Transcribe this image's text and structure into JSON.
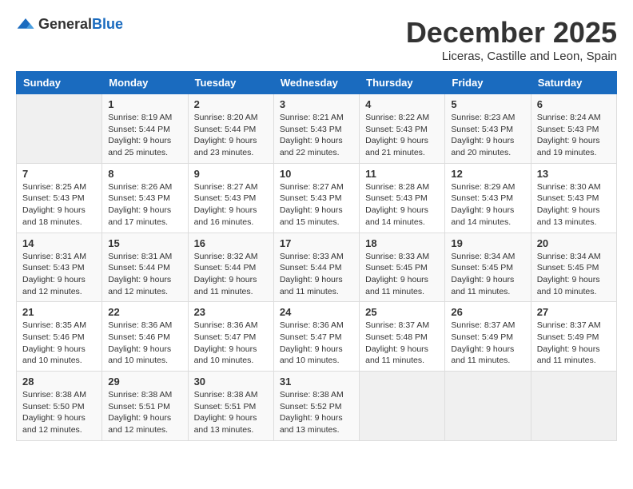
{
  "header": {
    "logo_general": "General",
    "logo_blue": "Blue",
    "month_year": "December 2025",
    "location": "Liceras, Castille and Leon, Spain"
  },
  "days_of_week": [
    "Sunday",
    "Monday",
    "Tuesday",
    "Wednesday",
    "Thursday",
    "Friday",
    "Saturday"
  ],
  "weeks": [
    [
      {
        "day": "",
        "info": ""
      },
      {
        "day": "1",
        "info": "Sunrise: 8:19 AM\nSunset: 5:44 PM\nDaylight: 9 hours\nand 25 minutes."
      },
      {
        "day": "2",
        "info": "Sunrise: 8:20 AM\nSunset: 5:44 PM\nDaylight: 9 hours\nand 23 minutes."
      },
      {
        "day": "3",
        "info": "Sunrise: 8:21 AM\nSunset: 5:43 PM\nDaylight: 9 hours\nand 22 minutes."
      },
      {
        "day": "4",
        "info": "Sunrise: 8:22 AM\nSunset: 5:43 PM\nDaylight: 9 hours\nand 21 minutes."
      },
      {
        "day": "5",
        "info": "Sunrise: 8:23 AM\nSunset: 5:43 PM\nDaylight: 9 hours\nand 20 minutes."
      },
      {
        "day": "6",
        "info": "Sunrise: 8:24 AM\nSunset: 5:43 PM\nDaylight: 9 hours\nand 19 minutes."
      }
    ],
    [
      {
        "day": "7",
        "info": "Sunrise: 8:25 AM\nSunset: 5:43 PM\nDaylight: 9 hours\nand 18 minutes."
      },
      {
        "day": "8",
        "info": "Sunrise: 8:26 AM\nSunset: 5:43 PM\nDaylight: 9 hours\nand 17 minutes."
      },
      {
        "day": "9",
        "info": "Sunrise: 8:27 AM\nSunset: 5:43 PM\nDaylight: 9 hours\nand 16 minutes."
      },
      {
        "day": "10",
        "info": "Sunrise: 8:27 AM\nSunset: 5:43 PM\nDaylight: 9 hours\nand 15 minutes."
      },
      {
        "day": "11",
        "info": "Sunrise: 8:28 AM\nSunset: 5:43 PM\nDaylight: 9 hours\nand 14 minutes."
      },
      {
        "day": "12",
        "info": "Sunrise: 8:29 AM\nSunset: 5:43 PM\nDaylight: 9 hours\nand 14 minutes."
      },
      {
        "day": "13",
        "info": "Sunrise: 8:30 AM\nSunset: 5:43 PM\nDaylight: 9 hours\nand 13 minutes."
      }
    ],
    [
      {
        "day": "14",
        "info": "Sunrise: 8:31 AM\nSunset: 5:43 PM\nDaylight: 9 hours\nand 12 minutes."
      },
      {
        "day": "15",
        "info": "Sunrise: 8:31 AM\nSunset: 5:44 PM\nDaylight: 9 hours\nand 12 minutes."
      },
      {
        "day": "16",
        "info": "Sunrise: 8:32 AM\nSunset: 5:44 PM\nDaylight: 9 hours\nand 11 minutes."
      },
      {
        "day": "17",
        "info": "Sunrise: 8:33 AM\nSunset: 5:44 PM\nDaylight: 9 hours\nand 11 minutes."
      },
      {
        "day": "18",
        "info": "Sunrise: 8:33 AM\nSunset: 5:45 PM\nDaylight: 9 hours\nand 11 minutes."
      },
      {
        "day": "19",
        "info": "Sunrise: 8:34 AM\nSunset: 5:45 PM\nDaylight: 9 hours\nand 11 minutes."
      },
      {
        "day": "20",
        "info": "Sunrise: 8:34 AM\nSunset: 5:45 PM\nDaylight: 9 hours\nand 10 minutes."
      }
    ],
    [
      {
        "day": "21",
        "info": "Sunrise: 8:35 AM\nSunset: 5:46 PM\nDaylight: 9 hours\nand 10 minutes."
      },
      {
        "day": "22",
        "info": "Sunrise: 8:36 AM\nSunset: 5:46 PM\nDaylight: 9 hours\nand 10 minutes."
      },
      {
        "day": "23",
        "info": "Sunrise: 8:36 AM\nSunset: 5:47 PM\nDaylight: 9 hours\nand 10 minutes."
      },
      {
        "day": "24",
        "info": "Sunrise: 8:36 AM\nSunset: 5:47 PM\nDaylight: 9 hours\nand 10 minutes."
      },
      {
        "day": "25",
        "info": "Sunrise: 8:37 AM\nSunset: 5:48 PM\nDaylight: 9 hours\nand 11 minutes."
      },
      {
        "day": "26",
        "info": "Sunrise: 8:37 AM\nSunset: 5:49 PM\nDaylight: 9 hours\nand 11 minutes."
      },
      {
        "day": "27",
        "info": "Sunrise: 8:37 AM\nSunset: 5:49 PM\nDaylight: 9 hours\nand 11 minutes."
      }
    ],
    [
      {
        "day": "28",
        "info": "Sunrise: 8:38 AM\nSunset: 5:50 PM\nDaylight: 9 hours\nand 12 minutes."
      },
      {
        "day": "29",
        "info": "Sunrise: 8:38 AM\nSunset: 5:51 PM\nDaylight: 9 hours\nand 12 minutes."
      },
      {
        "day": "30",
        "info": "Sunrise: 8:38 AM\nSunset: 5:51 PM\nDaylight: 9 hours\nand 13 minutes."
      },
      {
        "day": "31",
        "info": "Sunrise: 8:38 AM\nSunset: 5:52 PM\nDaylight: 9 hours\nand 13 minutes."
      },
      {
        "day": "",
        "info": ""
      },
      {
        "day": "",
        "info": ""
      },
      {
        "day": "",
        "info": ""
      }
    ]
  ]
}
